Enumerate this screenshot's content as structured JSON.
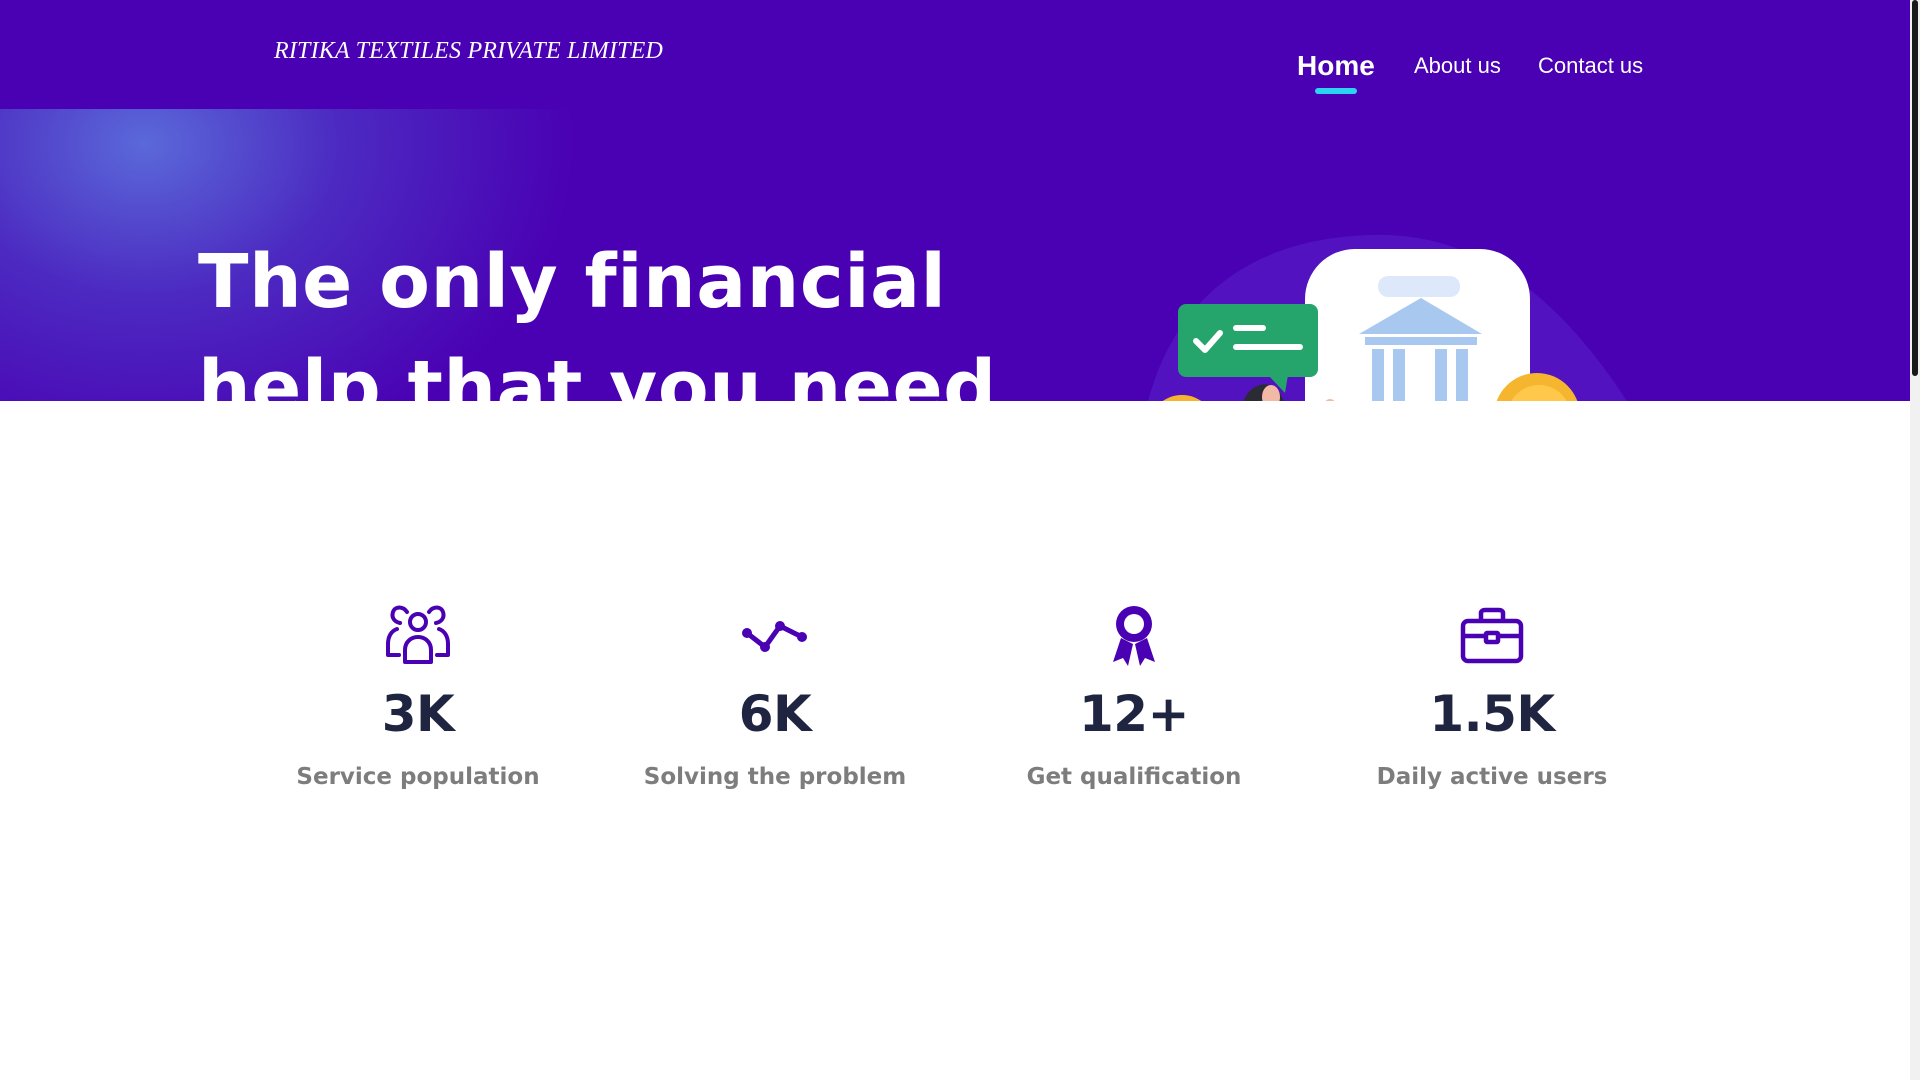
{
  "header": {
    "brand": "RITIKA TEXTILES PRIVATE LIMITED",
    "nav": {
      "home": "Home",
      "about": "About us",
      "contact": "Contact us"
    }
  },
  "hero": {
    "title_line1": "The only financial",
    "title_line2": "help that you need"
  },
  "stats": [
    {
      "icon": "users-group-icon",
      "value": "3K",
      "label": "Service population"
    },
    {
      "icon": "trend-line-icon",
      "value": "6K",
      "label": "Solving the problem"
    },
    {
      "icon": "award-ribbon-icon",
      "value": "12+",
      "label": "Get qualification"
    },
    {
      "icon": "briefcase-icon",
      "value": "1.5K",
      "label": "Daily active users"
    }
  ],
  "colors": {
    "brand_purple": "#4a00b3",
    "accent_cyan": "#2ed3f4",
    "stat_value": "#1f2540",
    "stat_label": "#7d7d7d"
  }
}
